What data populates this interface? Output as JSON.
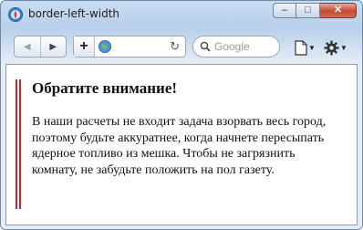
{
  "window": {
    "title": "border-left-width",
    "minimize_glyph": "–",
    "maximize_glyph": "□",
    "close_glyph": "✕"
  },
  "toolbar": {
    "back_glyph": "◀",
    "forward_glyph": "▶",
    "newtab_glyph": "+",
    "reload_glyph": "↻",
    "search_placeholder": "Google",
    "icons": [
      "back-icon",
      "forward-icon",
      "plus-icon",
      "globe-icon",
      "reload-icon",
      "search-icon",
      "page-icon",
      "gear-icon"
    ]
  },
  "page": {
    "heading": "Обратите внимание!",
    "body": "В наши расчеты не входит задача взорвать весь город, поэтому будьте аккуратнее, когда начнете пересыпать ядерное топливо из мешка. Чтобы не загрязнить комнату, не забудьте положить на пол газету."
  },
  "colors": {
    "accent_border": "#c8262c",
    "close_button": "#c7472e"
  }
}
